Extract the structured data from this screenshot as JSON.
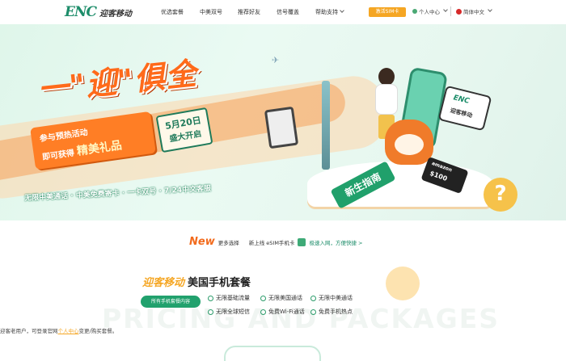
{
  "header": {
    "logo_mark": "ENC",
    "logo_text": "迎客移动",
    "nav": [
      "优选套餐",
      "中美双号",
      "推荐好友",
      "信号覆盖",
      "帮助支持"
    ],
    "sim_button": "激活SIM卡",
    "user_center": "个人中心",
    "language": "简体中文"
  },
  "banner": {
    "slogan": "一\"迎\"俱全",
    "promo_line1": "参与预热活动",
    "promo_line2_prefix": "即可获得",
    "promo_line2_highlight": "精美礼品",
    "date_line1": "5月20日",
    "date_line2": "盛大开启",
    "tagline": "无限中美通话 · 中美免费寄卡 · 一卡双号 · 7/24中文客服",
    "card_logo": "ENC",
    "card_subtitle": "迎客移动",
    "gift_brand": "amazon",
    "gift_value": "$100",
    "guide_label": "新生指南",
    "question_mark": "?"
  },
  "new_bar": {
    "tag": "New",
    "prefix": "更多选择",
    "launch": "新上线 eSIM手机卡",
    "link": "极速入网，方便快捷 >"
  },
  "packages": {
    "brand": "迎客移动",
    "title": "美国手机套餐",
    "all_button": "所有手机套餐内容",
    "watermark": "PRICING AND PACKAGES",
    "features": [
      "无限基础流量",
      "无限美国通话",
      "无限中美通话",
      "无限全球短信",
      "免费Wi-Fi通话",
      "免费手机热点"
    ]
  },
  "note": {
    "prefix": "迎客老用户，可登录官网",
    "link": "个人中心",
    "suffix": "变更/购买套餐。"
  }
}
